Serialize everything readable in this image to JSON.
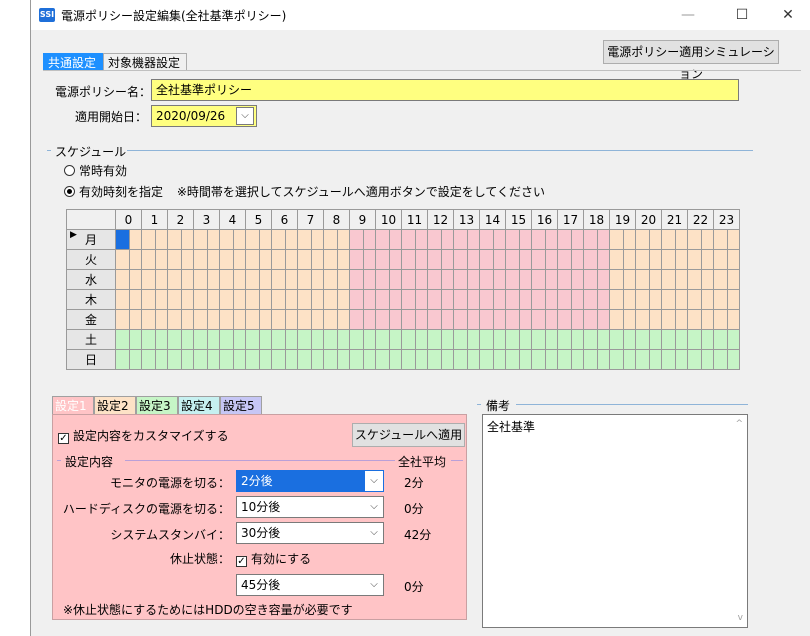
{
  "window": {
    "app_icon_text": "SSI",
    "title": "電源ポリシー設定編集(全社基準ポリシー)",
    "minimize": "—",
    "maximize": "☐",
    "close": "✕"
  },
  "tabs": [
    "共通設定",
    "対象機器設定"
  ],
  "simulation_button": "電源ポリシー適用シミュレーション",
  "policy_name": {
    "label": "電源ポリシー名：",
    "value": "全社基準ポリシー"
  },
  "start_date": {
    "label": "適用開始日：",
    "value": "2020/09/26"
  },
  "schedule": {
    "group_title": "スケジュール",
    "option_always": "常時有効",
    "option_specified": "有効時刻を指定",
    "note": "※時間帯を選択してスケジュールへ適用ボタンで設定をしてください",
    "hours": [
      "0",
      "1",
      "2",
      "3",
      "4",
      "5",
      "6",
      "7",
      "8",
      "9",
      "10",
      "11",
      "12",
      "13",
      "14",
      "15",
      "16",
      "17",
      "18",
      "19",
      "20",
      "21",
      "22",
      "23"
    ],
    "days": [
      "月",
      "火",
      "水",
      "木",
      "金",
      "土",
      "日"
    ],
    "current_row_marker": "▶"
  },
  "setting_tabs": [
    "設定1",
    "設定2",
    "設定3",
    "設定4",
    "設定5"
  ],
  "setting_tab_colors": [
    "#ffc4c6",
    "#fde2c6",
    "#c6f5c6",
    "#c6f0f0",
    "#c6c6f5"
  ],
  "customize_checkbox": {
    "label": "設定内容をカスタマイズする",
    "check": "✓"
  },
  "apply_button": "スケジュールへ適用",
  "settings": {
    "group_title": "設定内容",
    "average_title": "全社平均",
    "monitor": {
      "label": "モニタの電源を切る：",
      "value": "2分後",
      "average": "2分"
    },
    "disk": {
      "label": "ハードディスクの電源を切る：",
      "value": "10分後",
      "average": "0分"
    },
    "standby": {
      "label": "システムスタンバイ：",
      "value": "30分後",
      "average": "42分"
    },
    "hibernate": {
      "label": "休止状態：",
      "checkbox": "有効にする",
      "check": "✓",
      "value": "45分後",
      "average": "0分"
    },
    "note": "※休止状態にするためにはHDDの空き容量が必要です"
  },
  "notes": {
    "group_title": "備考",
    "text": "全社基準"
  },
  "icons": {
    "combo_arrow": "⌵",
    "scroll_up": "^",
    "scroll_down": "v"
  }
}
